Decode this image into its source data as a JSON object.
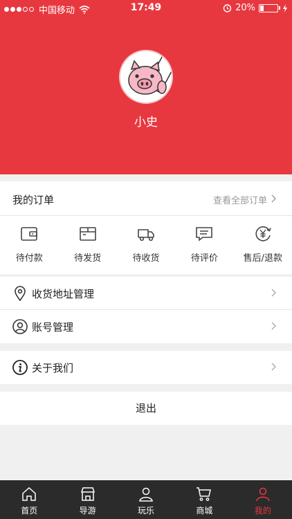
{
  "status_bar": {
    "carrier": "中国移动",
    "time": "17:49",
    "battery": "20%",
    "battery_level": 0.2
  },
  "profile": {
    "username": "小史"
  },
  "orders": {
    "title": "我的订单",
    "view_all": "查看全部订单",
    "items": [
      {
        "label": "待付款",
        "icon": "wallet-icon"
      },
      {
        "label": "待发货",
        "icon": "package-icon"
      },
      {
        "label": "待收货",
        "icon": "truck-icon"
      },
      {
        "label": "待评价",
        "icon": "comment-icon"
      },
      {
        "label": "售后/退款",
        "icon": "refund-icon"
      }
    ]
  },
  "menu": {
    "address": "收货地址管理",
    "account": "账号管理",
    "about": "关于我们",
    "logout": "退出"
  },
  "tabs": [
    {
      "label": "首页",
      "icon": "home-icon"
    },
    {
      "label": "导游",
      "icon": "shop-icon"
    },
    {
      "label": "玩乐",
      "icon": "person-icon"
    },
    {
      "label": "商城",
      "icon": "cart-icon"
    },
    {
      "label": "我的",
      "icon": "user-icon",
      "active": true
    }
  ],
  "colors": {
    "accent": "#e8383f",
    "tabbar": "#2b2b2b"
  }
}
